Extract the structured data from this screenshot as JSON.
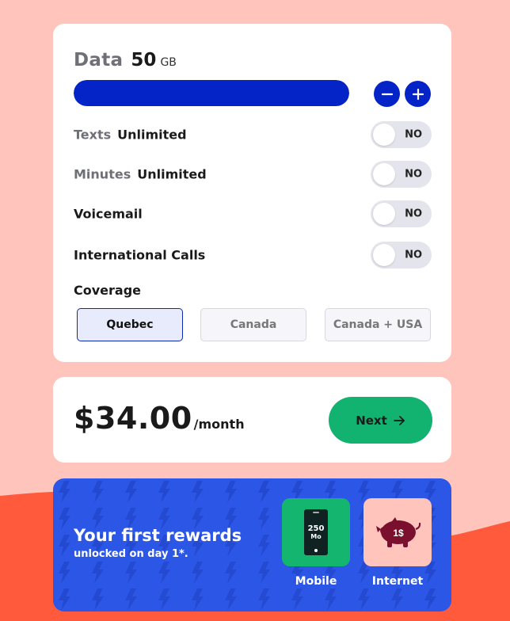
{
  "data": {
    "label": "Data",
    "value": "50",
    "unit": "GB",
    "level": 1.0,
    "decrease_label": "−",
    "increase_label": "+"
  },
  "options": [
    {
      "key": "Texts",
      "value": "Unlimited",
      "toggle": "NO"
    },
    {
      "key": "Minutes",
      "value": "Unlimited",
      "toggle": "NO"
    },
    {
      "key": "Voicemail",
      "value": "",
      "toggle": "NO"
    },
    {
      "key": "International Calls",
      "value": "",
      "toggle": "NO"
    }
  ],
  "coverage": {
    "title": "Coverage",
    "choices": [
      "Quebec",
      "Canada",
      "Canada + USA"
    ],
    "selected": "Quebec"
  },
  "price": {
    "amount": "$34.00",
    "period": "/month",
    "next_label": "Next"
  },
  "rewards": {
    "title": "Your first rewards",
    "subtitle": "unlocked on day 1*.",
    "mobile": {
      "label": "Mobile",
      "badge_value": "250",
      "badge_unit": "Mo"
    },
    "internet": {
      "label": "Internet",
      "badge_value": "1$"
    }
  },
  "colors": {
    "background": "#ffc4bc",
    "wave": "#ff5a3c",
    "accent_blue": "#0424c8",
    "next_green": "#12b370",
    "rewards_blue": "#2c57e6"
  }
}
